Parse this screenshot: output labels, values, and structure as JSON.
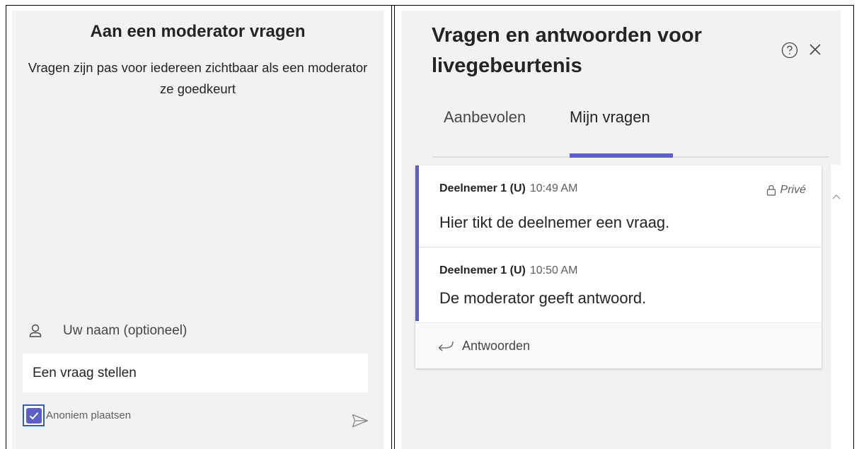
{
  "ask_panel": {
    "title": "Aan een moderator vragen",
    "subtitle": "Vragen zijn pas voor iedereen zichtbaar als een moderator ze goedkeurt",
    "name_label": "Uw naam (optioneel)",
    "question_placeholder": "Een vraag stellen",
    "anonymous_label": "Anoniem plaatsen",
    "anonymous_checked": true,
    "icons": {
      "name": "person-icon",
      "send": "send-icon",
      "checkbox": "checkmark-icon"
    },
    "accent_color": "#5b5fc7"
  },
  "qa_panel": {
    "title": "Vragen en antwoorden voor livegebeurtenis",
    "icons": {
      "help": "help-circle-icon",
      "close": "close-icon"
    },
    "tabs": [
      {
        "label": "Aanbevolen",
        "active": false
      },
      {
        "label": "Mijn vragen",
        "active": true
      }
    ],
    "thread": {
      "messages": [
        {
          "author": "Deelnemer 1 (U)",
          "time": "10:49 AM",
          "text": "Hier tikt de deelnemer een vraag.",
          "badge": "Privé"
        },
        {
          "author": "Deelnemer 1 (U)",
          "time": "10:50 AM",
          "text": "De moderator geeft antwoord."
        }
      ],
      "reply_label": "Antwoorden"
    }
  }
}
